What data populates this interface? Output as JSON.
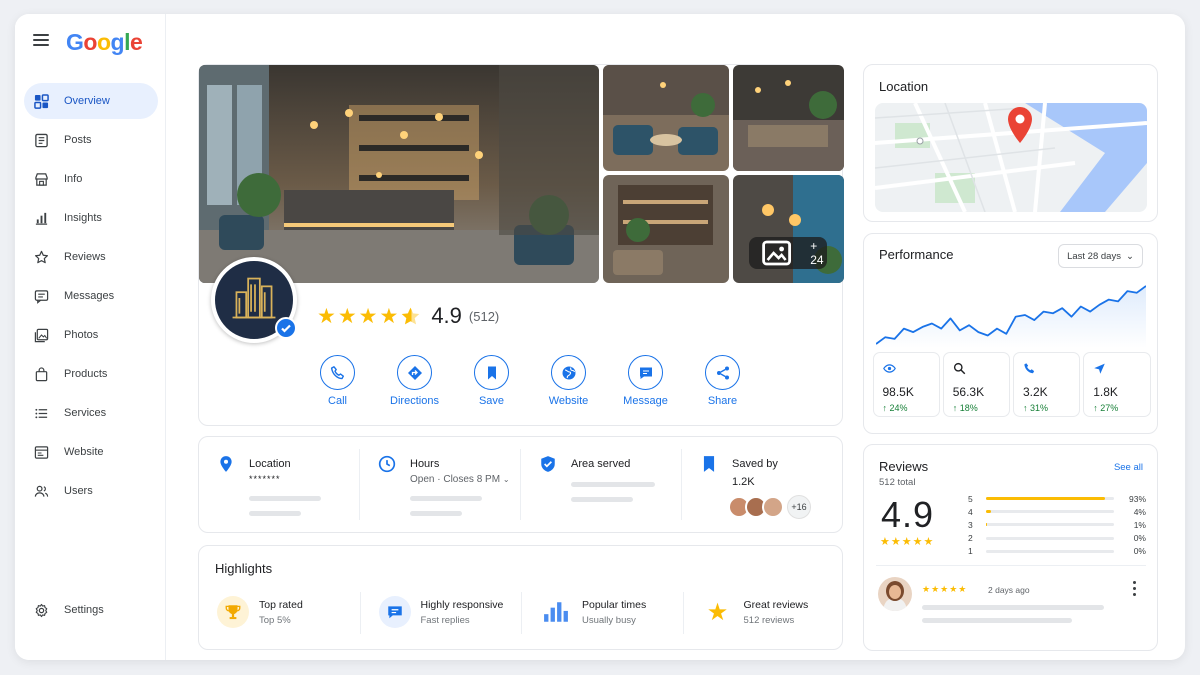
{
  "brand": {
    "logo_letters": [
      "G",
      "o",
      "o",
      "g",
      "l",
      "e"
    ]
  },
  "sidebar": {
    "items": [
      {
        "label": "Overview",
        "icon": "dashboard-icon",
        "active": true
      },
      {
        "label": "Posts",
        "icon": "posts-icon"
      },
      {
        "label": "Info",
        "icon": "storefront-icon"
      },
      {
        "label": "Insights",
        "icon": "bar-chart-icon"
      },
      {
        "label": "Reviews",
        "icon": "star-outline-icon"
      },
      {
        "label": "Messages",
        "icon": "message-icon"
      },
      {
        "label": "Photos",
        "icon": "photos-icon"
      },
      {
        "label": "Products",
        "icon": "shopping-bag-icon"
      },
      {
        "label": "Services",
        "icon": "list-icon"
      },
      {
        "label": "Website",
        "icon": "web-icon"
      },
      {
        "label": "Users",
        "icon": "users-icon"
      }
    ],
    "settings_label": "Settings"
  },
  "hero": {
    "more_photos": "+ 24",
    "rating_value": "4.9",
    "rating_count": "(512)",
    "stars": 4.5,
    "actions": [
      {
        "label": "Call",
        "icon": "phone-icon"
      },
      {
        "label": "Directions",
        "icon": "directions-icon"
      },
      {
        "label": "Save",
        "icon": "bookmark-icon"
      },
      {
        "label": "Website",
        "icon": "globe-icon"
      },
      {
        "label": "Message",
        "icon": "chat-icon"
      },
      {
        "label": "Share",
        "icon": "share-icon"
      }
    ]
  },
  "info": {
    "location": {
      "title": "Location",
      "value": "*******"
    },
    "hours": {
      "title": "Hours",
      "value": "Open · Closes 8 PM"
    },
    "area": {
      "title": "Area served"
    },
    "saved": {
      "title": "Saved by",
      "value": "1.2K",
      "more": "+16"
    }
  },
  "highlights": {
    "title": "Highlights",
    "items": [
      {
        "title": "Top rated",
        "sub": "Top 5%",
        "icon": "trophy-icon"
      },
      {
        "title": "Highly responsive",
        "sub": "Fast replies",
        "icon": "chat-bubble-icon"
      },
      {
        "title": "Popular times",
        "sub": "Usually busy",
        "icon": "bar-chart-icon"
      },
      {
        "title": "Great reviews",
        "sub": "512 reviews",
        "icon": "star-icon"
      }
    ]
  },
  "location_card": {
    "title": "Location"
  },
  "performance": {
    "title": "Performance",
    "range": "Last 28 days",
    "trend": [
      5,
      9,
      8,
      14,
      12,
      15,
      17,
      14,
      20,
      13,
      16,
      12,
      10,
      14,
      11,
      21,
      22,
      19,
      24,
      23,
      26,
      21,
      27,
      24,
      28,
      31,
      30,
      36,
      35,
      39
    ],
    "metrics": [
      {
        "value": "98.5K",
        "delta": "↑ 24%",
        "icon": "eye-icon"
      },
      {
        "value": "56.3K",
        "delta": "↑ 18%",
        "icon": "search-icon"
      },
      {
        "value": "3.2K",
        "delta": "↑ 31%",
        "icon": "phone-icon"
      },
      {
        "value": "1.8K",
        "delta": "↑ 27%",
        "icon": "send-icon"
      }
    ]
  },
  "reviews": {
    "title": "Reviews",
    "total": "512 total",
    "see_all": "See all",
    "average": "4.9",
    "distribution": [
      {
        "star": "5",
        "pct": 93,
        "label": "93%"
      },
      {
        "star": "4",
        "pct": 4,
        "label": "4%"
      },
      {
        "star": "3",
        "pct": 1,
        "label": "1%"
      },
      {
        "star": "2",
        "pct": 0,
        "label": "0%"
      },
      {
        "star": "1",
        "pct": 0,
        "label": "0%"
      }
    ],
    "latest": {
      "stars": "★★★★★",
      "time": "2 days ago"
    }
  },
  "colors": {
    "accent": "#1a73e8",
    "star": "#fbbc04",
    "positive": "#188038"
  }
}
